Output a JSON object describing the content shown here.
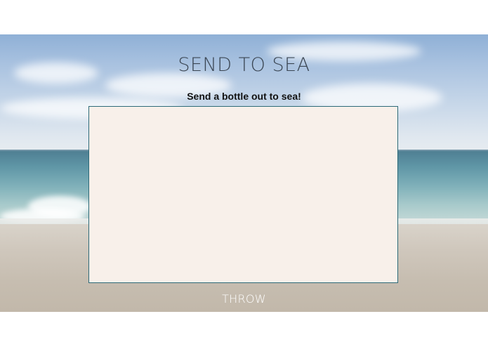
{
  "page": {
    "title": "SEND TO SEA",
    "subtitle": "Send a bottle out to sea!"
  },
  "message_box": {
    "value": "",
    "placeholder": ""
  },
  "actions": {
    "throw_label": "THROW"
  },
  "colors": {
    "textarea_background": "#f8f0ea",
    "textarea_border": "#2d6a78",
    "title_color": "#3b4653",
    "button_text": "#ffffff"
  }
}
